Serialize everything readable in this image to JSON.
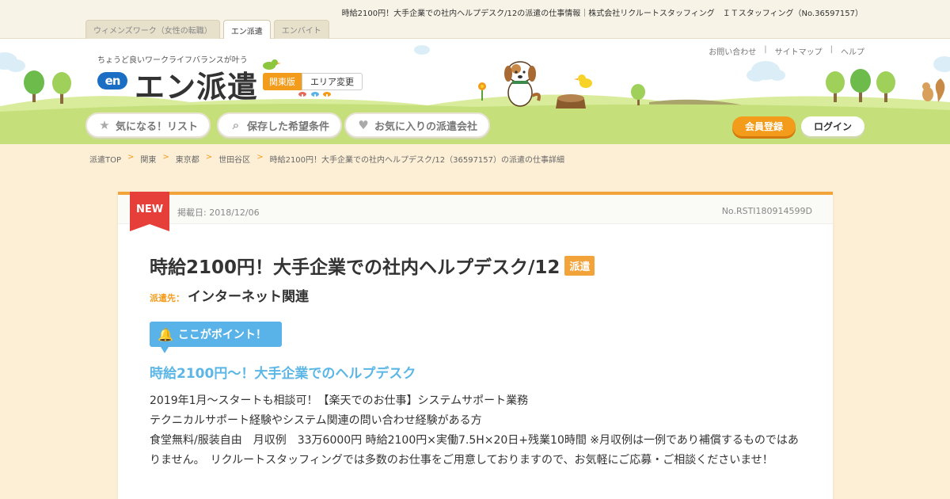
{
  "top": {
    "page_heading": "時給2100円！大手企業での社内ヘルプデスク/12の派遣の仕事情報｜株式会社リクルートスタッフィング　ＩＴスタッフィング（No.36597157）",
    "site_tabs": [
      {
        "label": "ウィメンズワーク（女性の転職）"
      },
      {
        "label": "エン派遣"
      },
      {
        "label": "エンバイト"
      }
    ]
  },
  "header": {
    "tagline": "ちょうど良いワークライフバランスが叶う",
    "logo_mark": "en",
    "logo_text": "エン派遣",
    "region_current": "関東版",
    "region_change": "エリア変更",
    "util_links": [
      "お問い合わせ",
      "サイトマップ",
      "ヘルプ"
    ],
    "util_sep": "|",
    "nav": [
      {
        "label": "気になる！リスト",
        "icon": "star-icon",
        "glyph": "★"
      },
      {
        "label": "保存した希望条件",
        "icon": "search-icon",
        "glyph": "⌕"
      },
      {
        "label": "お気に入りの派遣会社",
        "icon": "heart-icon",
        "glyph": "♥"
      }
    ],
    "register_label": "会員登録",
    "login_label": "ログイン"
  },
  "breadcrumb": {
    "sep": ">",
    "items": [
      "派遣TOP",
      "関東",
      "東京都",
      "世田谷区",
      "時給2100円！大手企業での社内ヘルプデスク/12（36597157）の派遣の仕事詳細"
    ]
  },
  "job": {
    "new_label": "NEW",
    "post_date": "掲載日: 2018/12/06",
    "job_no": "No.RSTI180914599D",
    "title": "時給2100円！大手企業での社内ヘルプデスク/12",
    "type_badge": "派遣",
    "dest_label": "派遣先：",
    "dest_value": "インターネット関連",
    "point_label": "ここがポイント！",
    "point_heading": "時給2100円～！大手企業でのヘルプデスク",
    "body_lines": [
      "2019年1月～スタートも相談可！【楽天でのお仕事】システムサポート業務",
      "テクニカルサポート経験やシステム関連の問い合わせ経験がある方",
      "食堂無料/服装自由　月収例　33万6000円 時給2100円×実働7.5H×20日+残業10時間 ※月収例は一例であり補償するものではありません。　リクルートスタッフィングでは多数のお仕事をご用意しておりますので、お気軽にご応募・ご相談くださいませ！"
    ]
  },
  "colors": {
    "accent": "#f39b1a",
    "new_red": "#e63f3a",
    "point_blue": "#59b3e8",
    "page_bg": "#fdefd5",
    "grass": "#c5e07a"
  }
}
